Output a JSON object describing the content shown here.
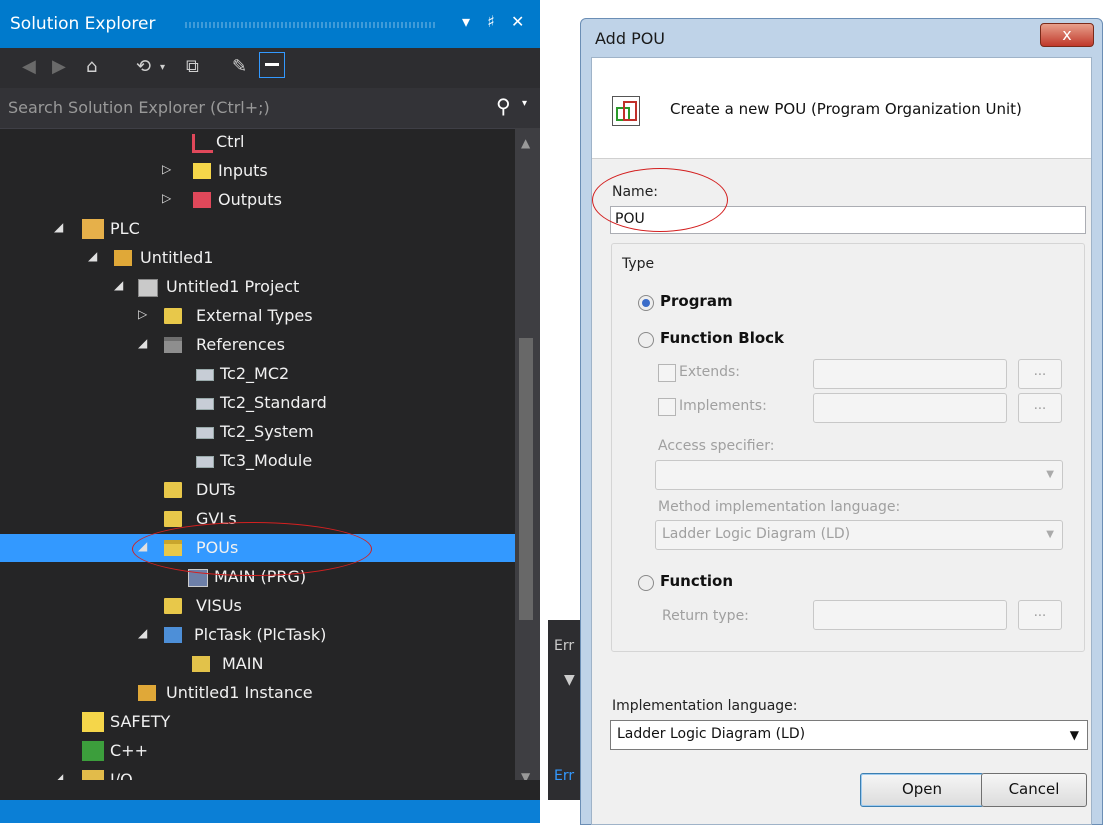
{
  "solution_explorer": {
    "title": "Solution Explorer",
    "search_placeholder": "Search Solution Explorer (Ctrl+;)",
    "title_controls": [
      "▾",
      "♯",
      "✕"
    ],
    "tree": [
      {
        "label": "Ctrl",
        "icon": "ctrl-icon"
      },
      {
        "label": "Inputs",
        "icon": "inputs-icon"
      },
      {
        "label": "Outputs",
        "icon": "outputs-icon"
      },
      {
        "label": "PLC",
        "icon": "plc-icon"
      },
      {
        "label": "Untitled1",
        "icon": "plc-project-icon"
      },
      {
        "label": "Untitled1 Project",
        "icon": "project-icon"
      },
      {
        "label": "External Types",
        "icon": "folder-icon"
      },
      {
        "label": "References",
        "icon": "folder-open-icon"
      },
      {
        "label": "Tc2_MC2",
        "icon": "library-reference-icon"
      },
      {
        "label": "Tc2_Standard",
        "icon": "library-reference-icon"
      },
      {
        "label": "Tc2_System",
        "icon": "library-reference-icon"
      },
      {
        "label": "Tc3_Module",
        "icon": "library-reference-icon"
      },
      {
        "label": "DUTs",
        "icon": "folder-icon"
      },
      {
        "label": "GVLs",
        "icon": "folder-icon"
      },
      {
        "label": "POUs",
        "icon": "folder-open-icon",
        "selected": true
      },
      {
        "label": "MAIN (PRG)",
        "icon": "program-icon"
      },
      {
        "label": "VISUs",
        "icon": "folder-icon"
      },
      {
        "label": "PlcTask (PlcTask)",
        "icon": "task-icon"
      },
      {
        "label": "MAIN",
        "icon": "task-program-icon"
      },
      {
        "label": "Untitled1 Instance",
        "icon": "instance-icon"
      },
      {
        "label": "SAFETY",
        "icon": "safety-icon"
      },
      {
        "label": "C++",
        "icon": "cpp-icon"
      },
      {
        "label": "I/O",
        "icon": "io-icon"
      }
    ]
  },
  "error_panel": {
    "label1": "Err",
    "label2": "Err"
  },
  "dialog": {
    "title": "Add POU",
    "close_label": "x",
    "header_text": "Create a new POU (Program Organization Unit)",
    "name_label": "Name:",
    "name_value": "POU",
    "type_label": "Type",
    "program_label": "Program",
    "function_block_label": "Function Block",
    "extends_label": "Extends:",
    "implements_label": "Implements:",
    "dots_label": "...",
    "access_specifier_label": "Access specifier:",
    "method_impl_label": "Method implementation language:",
    "method_impl_value": "Ladder Logic Diagram (LD)",
    "function_label": "Function",
    "return_type_label": "Return type:",
    "impl_language_label": "Implementation language:",
    "impl_language_value": "Ladder Logic Diagram (LD)",
    "open_label": "Open",
    "cancel_label": "Cancel",
    "selected_type": "Program"
  },
  "colors": {
    "accent": "#007acc",
    "selection": "#3399ff",
    "annotation": "#d32020"
  }
}
